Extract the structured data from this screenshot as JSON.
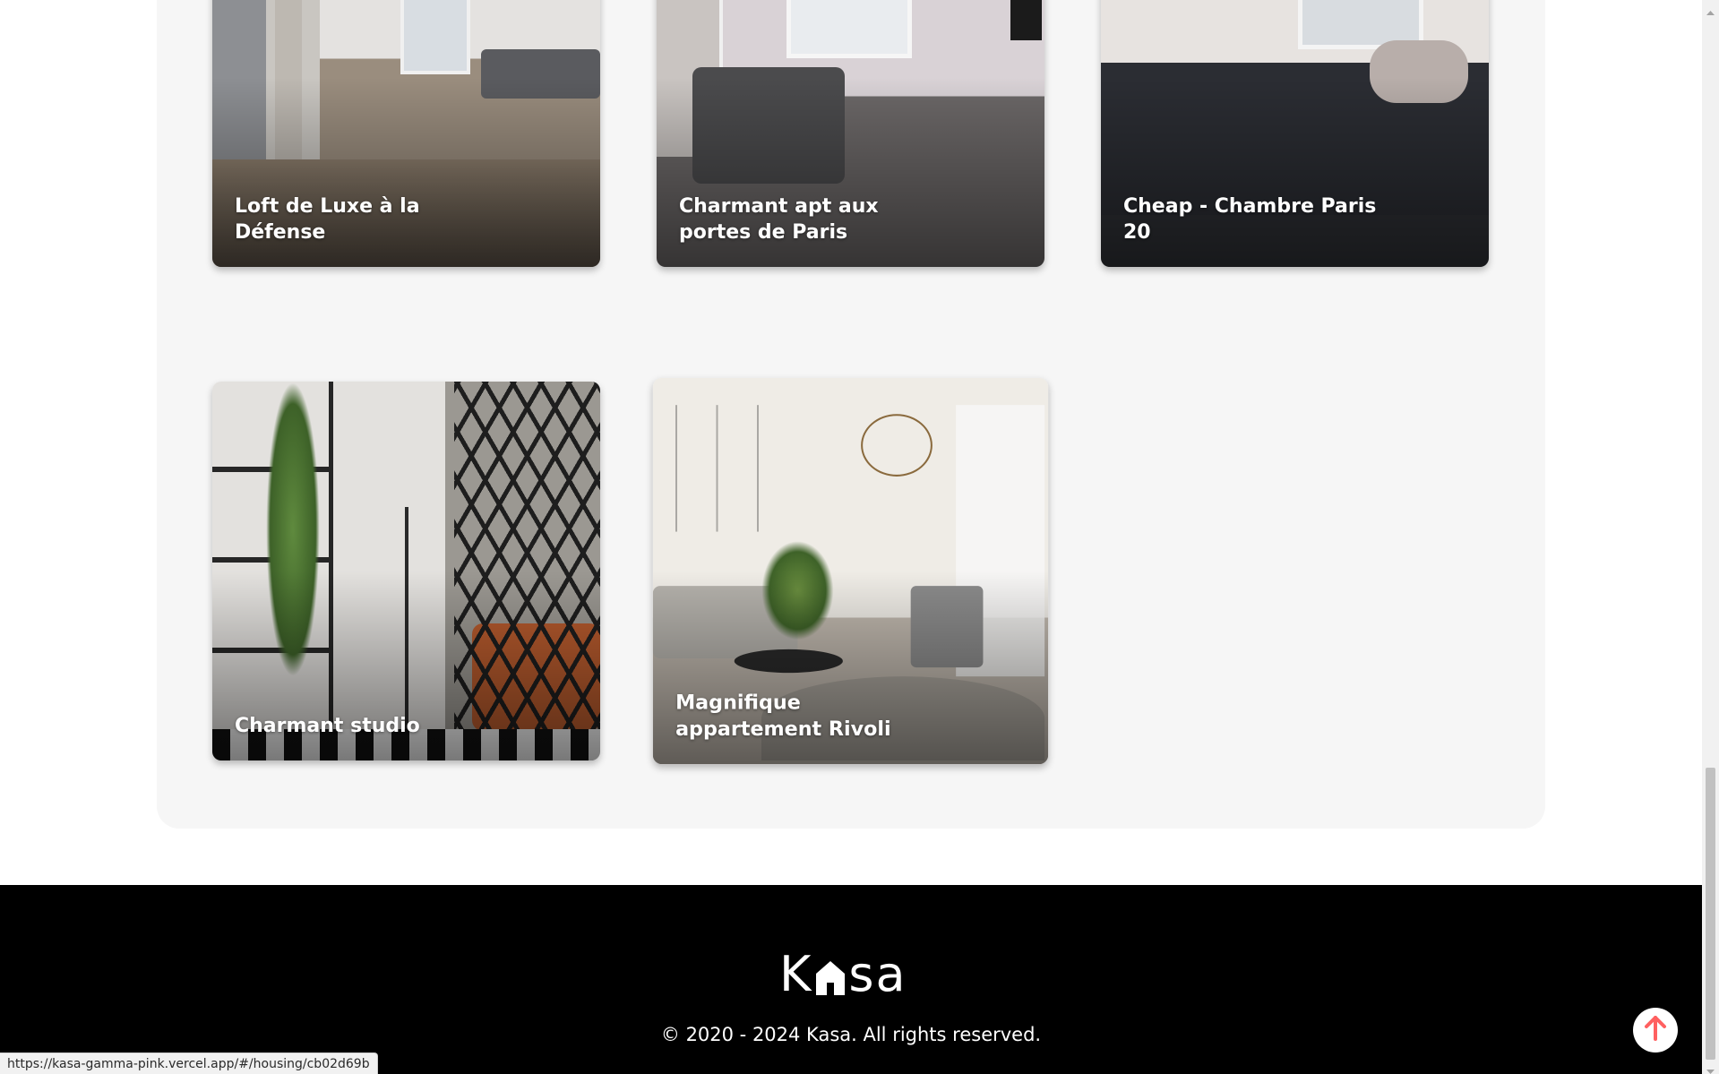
{
  "gallery": {
    "cards": [
      {
        "title": "Loft de Luxe à la Défense"
      },
      {
        "title": "Charmant apt aux portes de Paris"
      },
      {
        "title": "Cheap - Chambre Paris 20"
      },
      {
        "title": "Charmant studio"
      },
      {
        "title": "Magnifique appartement Rivoli"
      }
    ]
  },
  "footer": {
    "logo_text": "Kasa",
    "copyright": "© 2020 - 2024 Kasa. All rights reserved."
  },
  "status_bar": {
    "url": "https://kasa-gamma-pink.vercel.app/#/housing/cb02d69b"
  },
  "colors": {
    "accent": "#ff6060",
    "footer_bg": "#000000",
    "gallery_bg": "#f6f6f6"
  },
  "icons": {
    "back_to_top": "arrow-up-icon",
    "logo_house": "house-icon"
  }
}
